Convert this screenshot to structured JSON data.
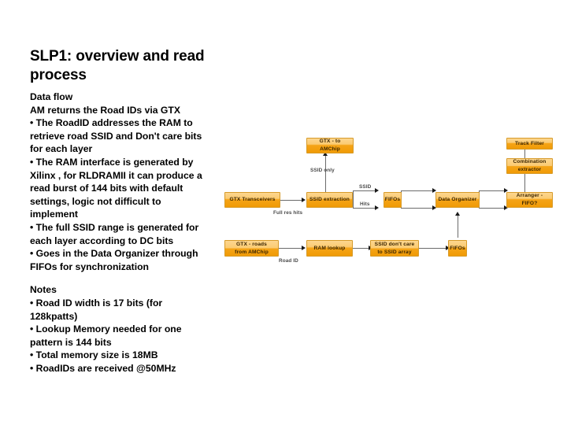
{
  "slide": {
    "title": "SLP1: overview and read process",
    "body_blocks": [
      "Data flow",
      "AM returns the Road IDs via GTX",
      "• The RoadID addresses the RAM to retrieve road SSID and Don't care bits for each layer",
      "• The RAM interface is generated by Xilinx , for RLDRAMII it can produce a read burst of 144 bits with default settings,  logic not difficult to implement",
      "• The full SSID range is generated for each layer according to DC bits",
      "• Goes in the Data Organizer through FIFOs for synchronization"
    ],
    "notes_heading": "Notes",
    "notes": [
      "• Road ID width is 17 bits (for 128kpatts)",
      "• Lookup Memory needed for one pattern is 144 bits",
      "• Total memory size is 18MB",
      "• RoadIDs are received @50MHz"
    ]
  },
  "diagram": {
    "accent_color": "#f5a417",
    "accent_light": "#fcd68f",
    "border_color": "#d79b2a",
    "connector_color": "#6b6b6b",
    "nodes": {
      "gtx_to_amchip": "GTX - to AMChip",
      "gtx_transceivers": "GTX Transceivers",
      "ssid_extraction": "SSID extraction",
      "fifos_top": "FIFOs",
      "data_organizer": "Data Organizer",
      "arranger_fifo": "Arranger - FIFO?",
      "combination_extractor_line1": "Combination",
      "combination_extractor_line2": "extractor",
      "track_filter": "Track Filter",
      "gtx_roads_line1": "GTX - roads",
      "gtx_roads_line2": "from AMChip",
      "ram_lookup": "RAM lookup",
      "ssid_dont_care_line1": "SSID don't care",
      "ssid_dont_care_line2": "to SSID array",
      "fifos_bottom": "FIFOs"
    },
    "edge_labels": {
      "ssid_only": "SSID only",
      "full_res_hits": "Full res hits",
      "ssid": "SSID",
      "hits": "Hits",
      "road_id": "Road ID"
    }
  }
}
